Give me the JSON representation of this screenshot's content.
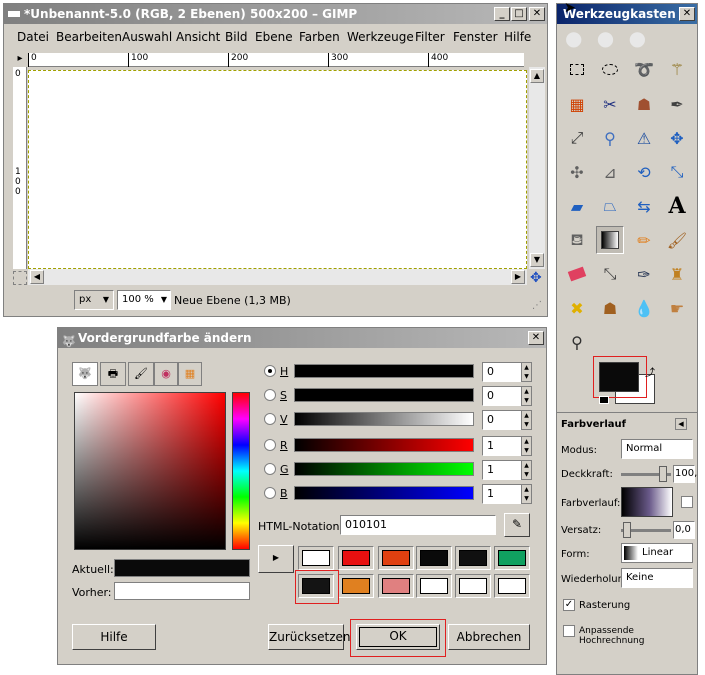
{
  "gimp_window": {
    "title": "*Unbenannt-5.0 (RGB, 2 Ebenen) 500x200 – GIMP",
    "menu": [
      "Datei",
      "Bearbeiten",
      "Auswahl",
      "Ansicht",
      "Bild",
      "Ebene",
      "Farben",
      "Werkzeuge",
      "Filter",
      "Fenster",
      "Hilfe"
    ],
    "ruler_h": [
      "0",
      "100",
      "200",
      "300",
      "400"
    ],
    "ruler_v": [
      "0",
      "1",
      "0",
      "0"
    ],
    "unit": "px",
    "zoom": "100 %",
    "status": "Neue Ebene (1,3 MB)"
  },
  "toolbox": {
    "title": "Werkzeugkasten",
    "tools": [
      "rect-select",
      "ellipse-select",
      "free-select",
      "fuzzy-select",
      "color-select",
      "scissors",
      "foreground-select",
      "paths",
      "color-picker",
      "zoom",
      "measure",
      "move",
      "align",
      "crop",
      "rotate",
      "scale",
      "shear",
      "perspective",
      "flip",
      "text",
      "bucket-fill",
      "blend",
      "pencil",
      "paintbrush",
      "eraser",
      "airbrush",
      "ink",
      "clone",
      "heal",
      "smudge-blur",
      "dodge-burn",
      "smudge",
      "convolve"
    ],
    "panel_title": "Farbverlauf",
    "modus_label": "Modus:",
    "modus_value": "Normal",
    "deckkraft_label": "Deckkraft:",
    "deckkraft_value": "100,",
    "farbverlauf_label": "Farbverlauf:",
    "versatz_label": "Versatz:",
    "versatz_value": "0,0",
    "form_label": "Form:",
    "form_value": "Linear",
    "wiederholung_label": "Wiederholung:",
    "wiederholung_value": "Keine",
    "rasterung_label": "Rasterung",
    "hochrechnung_label": "Anpassende Hochrechnung",
    "fg_color": "#0a0a0a",
    "bg_color": "#ffffff"
  },
  "dialog": {
    "title": "Vordergrundfarbe ändern",
    "channels": [
      {
        "label": "H",
        "value": "0",
        "checked": true
      },
      {
        "label": "S",
        "value": "0",
        "checked": false
      },
      {
        "label": "V",
        "value": "0",
        "checked": false
      },
      {
        "label": "R",
        "value": "1",
        "checked": false
      },
      {
        "label": "G",
        "value": "1",
        "checked": false
      },
      {
        "label": "B",
        "value": "1",
        "checked": false
      }
    ],
    "html_label": "HTML-Notation:",
    "html_value": "010101",
    "aktuell_label": "Aktuell:",
    "vorher_label": "Vorher:",
    "history_colors": [
      "#ffffff",
      "#e81010",
      "#e04010",
      "#0a0a0a",
      "#101010",
      "#10a060",
      "#141414",
      "#e08020",
      "#e08080",
      "#ffffff",
      "#ffffff",
      "#ffffff"
    ],
    "buttons": {
      "hilfe": "Hilfe",
      "zuruecksetzen": "Zurücksetzen",
      "ok": "OK",
      "abbrechen": "Abbrechen"
    }
  }
}
